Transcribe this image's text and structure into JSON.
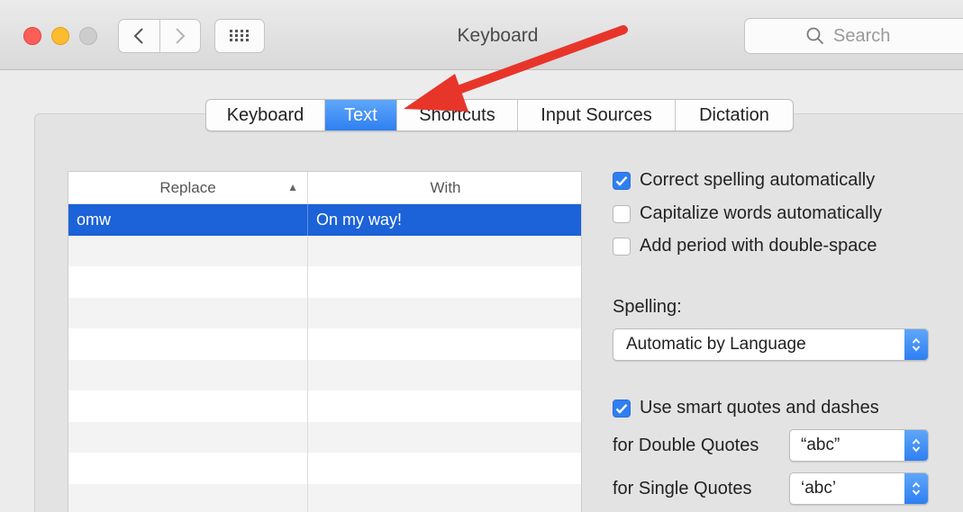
{
  "window": {
    "title": "Keyboard"
  },
  "search": {
    "placeholder": "Search"
  },
  "tabs": [
    {
      "label": "Keyboard",
      "active": false
    },
    {
      "label": "Text",
      "active": true
    },
    {
      "label": "Shortcuts",
      "active": false
    },
    {
      "label": "Input Sources",
      "active": false
    },
    {
      "label": "Dictation",
      "active": false
    }
  ],
  "table": {
    "headers": {
      "replace": "Replace",
      "with": "With"
    },
    "rows": [
      {
        "replace": "omw",
        "with": "On my way!",
        "selected": true
      }
    ]
  },
  "options": {
    "correct_spelling": {
      "label": "Correct spelling automatically",
      "checked": true
    },
    "capitalize": {
      "label": "Capitalize words automatically",
      "checked": false
    },
    "add_period": {
      "label": "Add period with double-space",
      "checked": false
    }
  },
  "spelling": {
    "label": "Spelling:",
    "value": "Automatic by Language"
  },
  "smart_quotes": {
    "label": "Use smart quotes and dashes",
    "checked": true,
    "double_label": "for Double Quotes",
    "double_value": "“abc”",
    "single_label": "for Single Quotes",
    "single_value": "‘abc’"
  },
  "colors": {
    "accent": "#2f7ff2",
    "selection": "#1c62d8",
    "annotation_arrow": "#e8352a"
  },
  "icons": [
    "chevron-left-icon",
    "chevron-right-icon",
    "grid-icon",
    "search-icon",
    "checkmark-icon",
    "stepper-icon",
    "sort-ascending-icon"
  ]
}
